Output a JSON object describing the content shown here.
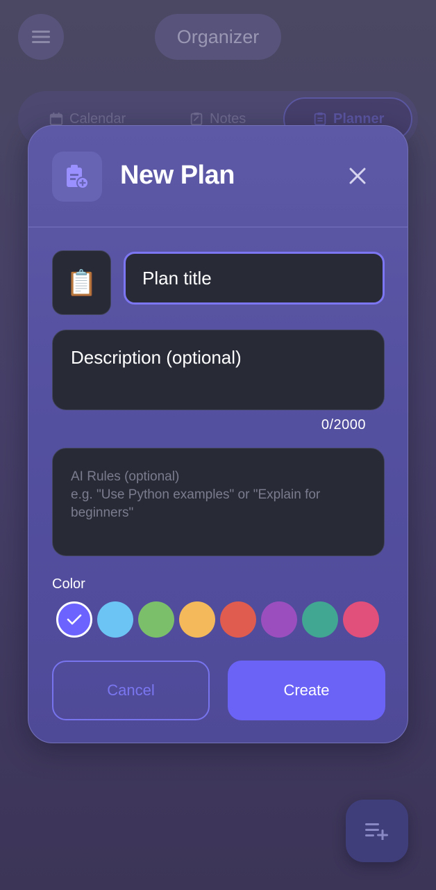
{
  "app": {
    "title": "Organizer"
  },
  "tabs": [
    {
      "label": "Calendar",
      "icon": "calendar-icon"
    },
    {
      "label": "Notes",
      "icon": "note-icon"
    },
    {
      "label": "Planner",
      "icon": "planner-icon",
      "active": true
    }
  ],
  "dialog": {
    "title": "New Plan",
    "icon": "clipboard-add-icon",
    "emoji": "📋",
    "title_placeholder": "Plan title",
    "description_placeholder": "Description (optional)",
    "char_counter": "0/2000",
    "ai_rules_title": "AI Rules (optional)",
    "ai_rules_hint": "e.g. \"Use Python examples\" or \"Explain for beginners\"",
    "color_label": "Color",
    "colors": [
      "#6c63ff",
      "#6cc4f5",
      "#7cbf6b",
      "#f4b95a",
      "#e05c4e",
      "#9b4fbf",
      "#41a692",
      "#e0507a"
    ],
    "selected_color": "#6c63ff",
    "cancel_label": "Cancel",
    "create_label": "Create"
  },
  "fab": {
    "icon": "playlist-add-icon"
  },
  "theme": {
    "accent": "#6b63f6",
    "surface": "#282a36"
  }
}
